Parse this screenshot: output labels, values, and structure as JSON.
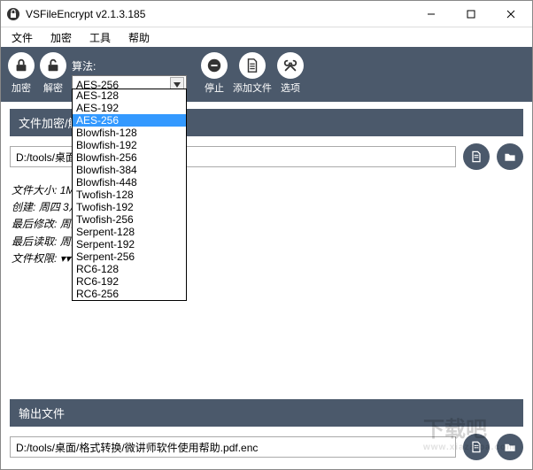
{
  "window": {
    "title": "VSFileEncrypt v2.1.3.185"
  },
  "menu": {
    "file": "文件",
    "encrypt": "加密",
    "tools": "工具",
    "help": "帮助"
  },
  "toolbar": {
    "encrypt_label": "加密",
    "decrypt_label": "解密",
    "stop_label": "停止",
    "addfile_label": "添加文件",
    "options_label": "选项",
    "algo_caption": "算法:",
    "algo_selected": "AES-256",
    "algo_options": [
      "AES-128",
      "AES-192",
      "AES-256",
      "Blowfish-128",
      "Blowfish-192",
      "Blowfish-256",
      "Blowfish-384",
      "Blowfish-448",
      "Twofish-128",
      "Twofish-192",
      "Twofish-256",
      "Serpent-128",
      "Serpent-192",
      "Serpent-256",
      "RC6-128",
      "RC6-192",
      "RC6-256"
    ],
    "algo_selected_index": 2
  },
  "section_input": {
    "header": "文件加密/解",
    "path": "D:/tools/桌面/                         帮助.pdf"
  },
  "fileinfo": {
    "size_label": "文件大小:",
    "size_value": "1MB",
    "created_label": "创建:",
    "created_value": "周四 3月",
    "modified_label": "最后修改:",
    "modified_value": "周四",
    "accessed_label": "最后读取:",
    "accessed_value": "周四",
    "perm_label": "文件权限:",
    "perm_value": "▾▾"
  },
  "section_output": {
    "header": "输出文件",
    "path": "D:/tools/桌面/格式转换/微讲师软件使用帮助.pdf.enc"
  },
  "watermark": {
    "main": "下载吧",
    "sub": "www.xiazaiba.com"
  }
}
